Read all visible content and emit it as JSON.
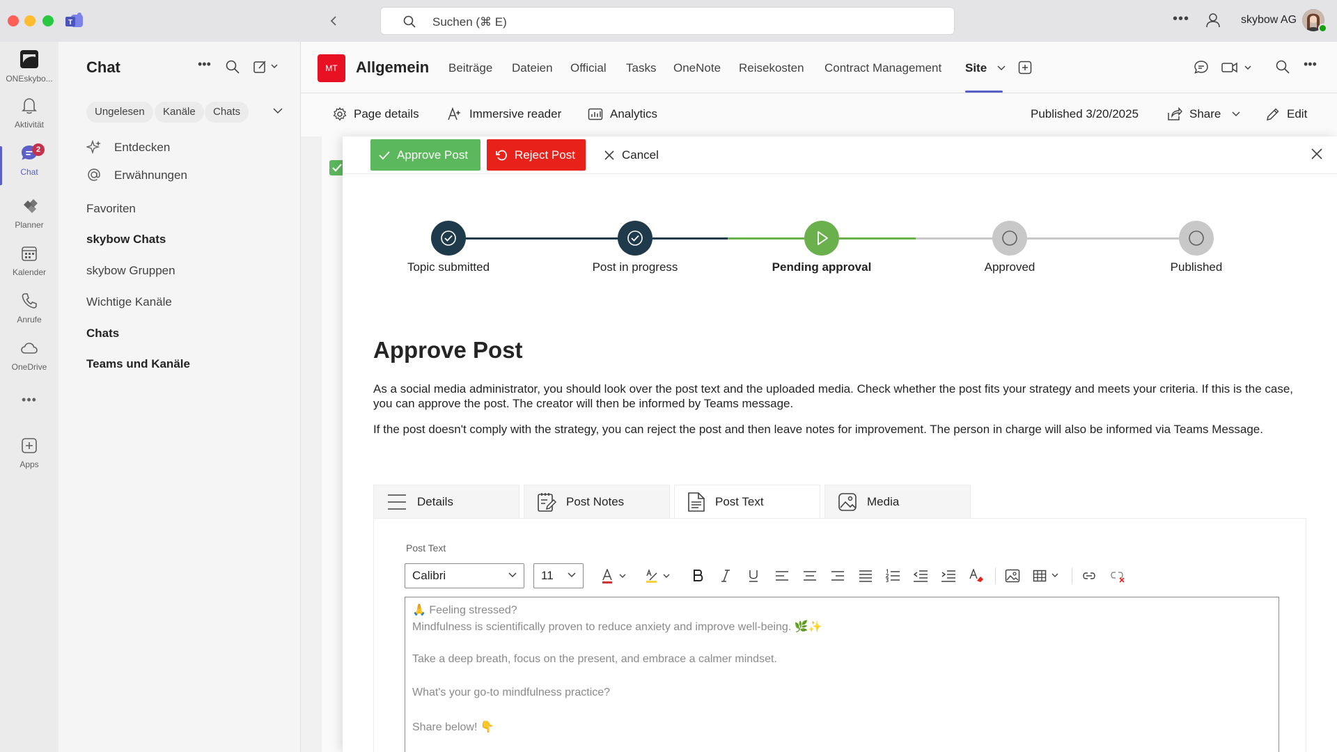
{
  "titlebar": {
    "search_placeholder": "Suchen (⌘ E)",
    "org_name": "skybow AG"
  },
  "rail": {
    "items": [
      {
        "label": "ONEskybo...",
        "icon": "oneskybow-app-icon"
      },
      {
        "label": "Aktivität",
        "icon": "bell-icon"
      },
      {
        "label": "Chat",
        "icon": "chat-icon",
        "badge": "2",
        "active": true
      },
      {
        "label": "Planner",
        "icon": "planner-icon"
      },
      {
        "label": "Kalender",
        "icon": "calendar-icon"
      },
      {
        "label": "Anrufe",
        "icon": "phone-icon"
      },
      {
        "label": "OneDrive",
        "icon": "cloud-icon"
      },
      {
        "label": "Apps",
        "icon": "add-apps-icon"
      }
    ]
  },
  "chat_panel": {
    "title": "Chat",
    "filters": [
      "Ungelesen",
      "Kanäle",
      "Chats"
    ],
    "entries": [
      {
        "label": "Entdecken",
        "icon": "sparkle-icon"
      },
      {
        "label": "Erwähnungen",
        "icon": "mention-icon"
      }
    ],
    "sections": [
      {
        "label": "Favoriten",
        "bold": false
      },
      {
        "label": "skybow Chats",
        "bold": true
      },
      {
        "label": "skybow Gruppen",
        "bold": false
      },
      {
        "label": "Wichtige Kanäle",
        "bold": false
      },
      {
        "label": "Chats",
        "bold": true
      },
      {
        "label": "Teams und Kanäle",
        "bold": true
      }
    ]
  },
  "channel": {
    "team_initials": "MT",
    "name": "Allgemein",
    "tabs": [
      "Beiträge",
      "Dateien",
      "Official",
      "Tasks",
      "OneNote",
      "Reisekosten",
      "Contract Management",
      "Site"
    ],
    "active_tab": "Site"
  },
  "page_toolbar": {
    "page_details": "Page details",
    "immersive_reader": "Immersive reader",
    "analytics": "Analytics",
    "published": "Published 3/20/2025",
    "share": "Share",
    "edit": "Edit"
  },
  "dialog": {
    "approve_label": "Approve Post",
    "reject_label": "Reject Post",
    "cancel_label": "Cancel",
    "steps": [
      {
        "label": "Topic submitted",
        "state": "done"
      },
      {
        "label": "Post in progress",
        "state": "done"
      },
      {
        "label": "Pending approval",
        "state": "current"
      },
      {
        "label": "Approved",
        "state": "pending"
      },
      {
        "label": "Published",
        "state": "pending"
      }
    ],
    "title": "Approve Post",
    "paragraph1": "As a social media administrator, you should look over the post text and the uploaded media. Check whether the post fits your strategy and meets your criteria. If this is the case, you can approve the post. The creator will then be informed by Teams message.",
    "paragraph2": "If the post doesn't comply with the strategy, you can reject the post and then leave notes for improvement. The person in charge will also be informed via Teams Message.",
    "tabs": [
      {
        "label": "Details",
        "icon": "list-lines-icon"
      },
      {
        "label": "Post Notes",
        "icon": "notes-edit-icon"
      },
      {
        "label": "Post Text",
        "icon": "document-text-icon",
        "active": true
      },
      {
        "label": "Media",
        "icon": "image-icon"
      }
    ],
    "editor": {
      "field_label": "Post Text",
      "font": "Calibri",
      "size": "11",
      "lines": [
        "🙏 Feeling stressed?",
        "Mindfulness is scientifically proven to reduce anxiety and improve well-being. 🌿✨",
        "",
        "Take a deep breath, focus on the present, and embrace a calmer mindset.",
        "",
        "What's your go-to mindfulness practice?",
        "",
        "Share below! 👇"
      ]
    }
  },
  "colors": {
    "accent": "#5b5fc7",
    "approve": "#5cb85c",
    "reject": "#e8221b",
    "step_done": "#1f3a4a",
    "step_current": "#6ab04c",
    "step_pending": "#c8c8c8"
  }
}
